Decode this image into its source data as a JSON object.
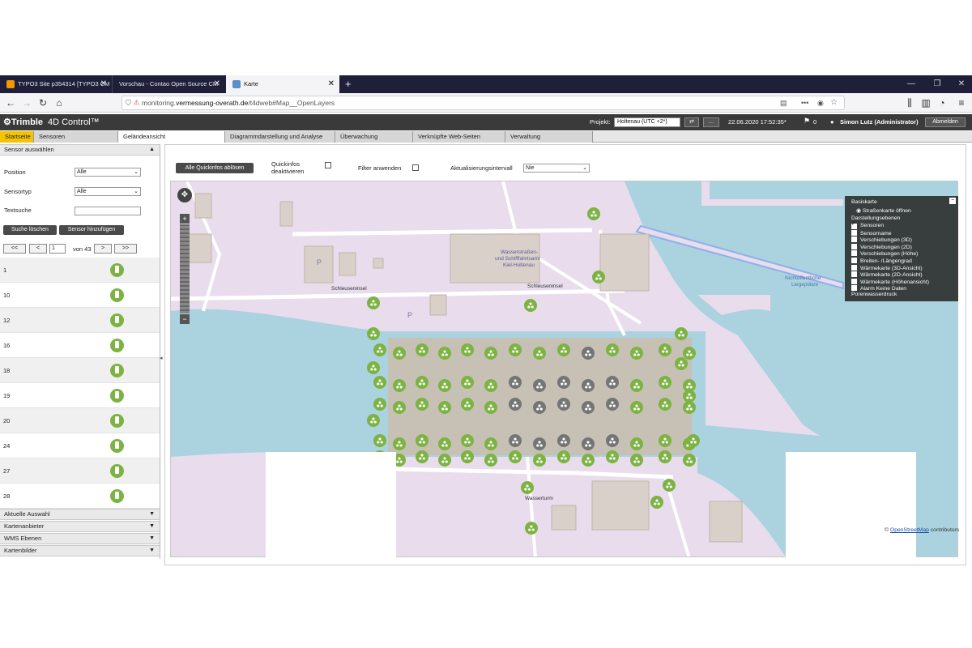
{
  "browser": {
    "tabs": [
      {
        "label": "TYPO3 Site p354314 [TYPO3 CM"
      },
      {
        "label": "Vorschau - Contao Open Source CM"
      },
      {
        "label": "Karte"
      }
    ],
    "new_tab": "+",
    "url_prefix": "monitoring.",
    "url_domain": "vermessung-overath.de",
    "url_path": "/t4dweb#Map__OpenLayers"
  },
  "app": {
    "logo": "Trimble",
    "product": "4D Control™",
    "project_label": "Projekt:",
    "project_value": "Holtenau (UTC +2*)",
    "datetime": "22.06.2020 17:52:35*",
    "flag_count": "0",
    "user": "Simon Lutz (Administrator)",
    "logout": "Abmelden",
    "tabs": [
      "Startseite",
      "Sensoren",
      "Geländeansicht",
      "Diagrammdarstellung und Analyse",
      "Überwachung",
      "Verknüpfte Web-Seiten",
      "Verwaltung"
    ]
  },
  "left": {
    "section_title": "Sensor auswählen",
    "position_label": "Position",
    "position_value": "Alle",
    "sensortyp_label": "Sensortyp",
    "sensortyp_value": "Alle",
    "textsuche_label": "Textsuche",
    "search_clear": "Suche löschen",
    "sensor_add": "Sensor hinzufügen",
    "pager_first": "<<",
    "pager_prev": "<",
    "pager_page": "1",
    "pager_of": "von 43",
    "pager_next": ">",
    "pager_last": ">>",
    "sensors": [
      "1",
      "10",
      "12",
      "16",
      "18",
      "19",
      "20",
      "24",
      "27",
      "28"
    ],
    "accordion": [
      "Aktuelle Auswahl",
      "Kartenanbieter",
      "WMS Ebenen",
      "Kartenbilder"
    ]
  },
  "toolbar": {
    "quickinfos_button": "Alle Quickinfos ablösen",
    "quickinfos_deactivate_l1": "Quickinfos",
    "quickinfos_deactivate_l2": "deaktivieren",
    "filter_label": "Filter anwenden",
    "interval_label": "Aktualisierungsintervall",
    "interval_value": "Nie"
  },
  "map": {
    "labels": {
      "schleuseninsel1": "Schleuseninsel",
      "schleuseninsel2": "Schleuseninsel",
      "wasserstrassen1": "Wasserstraßen-",
      "wasserstrassen2": "und Schifffahrtsamt",
      "wasserstrassen3": "Kiel-Holtenau",
      "nicht1": "Nichtoffentliche",
      "nicht2": "Liegeplätze",
      "turm": "Wasserturm",
      "parking1": "P",
      "parking2": "P"
    },
    "attribution_prefix": "©",
    "attribution_link": "OpenStreetMap",
    "attribution_suffix": "contributors",
    "colors": {
      "water": "#aad3df",
      "land": "#e8dced",
      "footprint": "#c6c0b5",
      "sensor_ok": "#7cb342",
      "sensor_gray": "#757575"
    }
  },
  "layers": {
    "title": "Basiskarte",
    "radio": "Straßenkarte öffnen",
    "group": "Darstellungsebenen",
    "items": [
      {
        "label": "Sensoren",
        "checked": true
      },
      {
        "label": "Sensorname",
        "checked": false
      },
      {
        "label": "Verschiebungen (3D)",
        "checked": false
      },
      {
        "label": "Verschiebungen (2D)",
        "checked": false
      },
      {
        "label": "Verschiebungen (Höhe)",
        "checked": false
      },
      {
        "label": "Breiten- /Längengrad",
        "checked": false
      },
      {
        "label": "Wärmekarte (3D-Ansicht)",
        "checked": false
      },
      {
        "label": "Wärmekarte (2D-Ansicht)",
        "checked": false
      },
      {
        "label": "Wärmekarte (Höhenansicht)",
        "checked": false
      },
      {
        "label": "Alarm Keine Daten",
        "checked": false
      }
    ],
    "footer": "Porenwasserdruck"
  }
}
